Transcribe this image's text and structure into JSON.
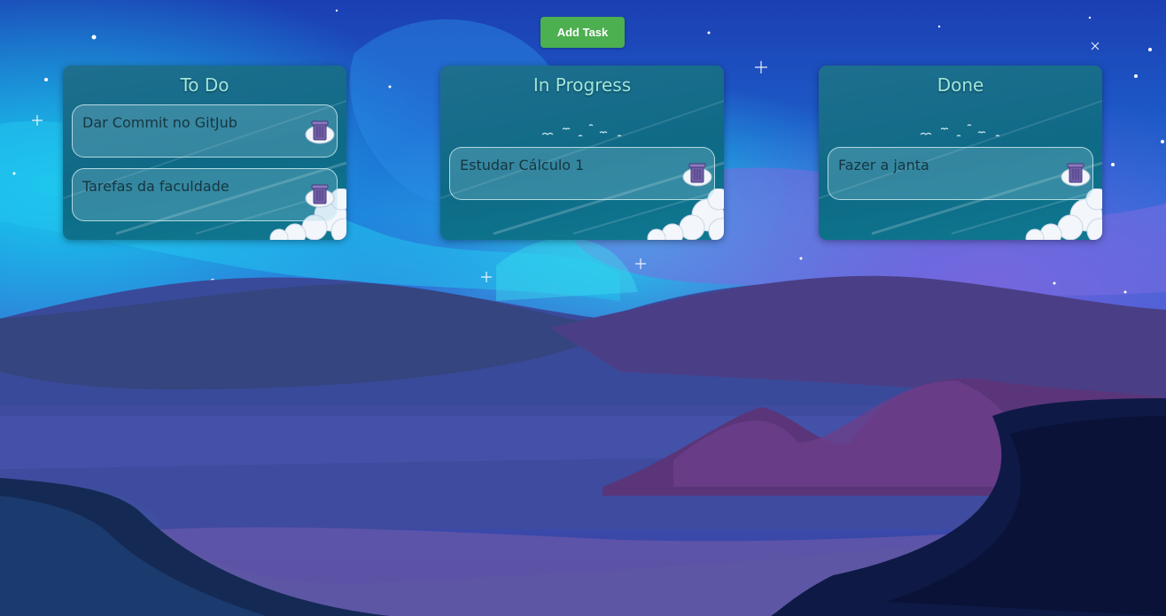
{
  "toolbar": {
    "add_task_label": "Add Task"
  },
  "columns": [
    {
      "title": "To Do",
      "tasks": [
        {
          "text": "Dar Commit no GitJub"
        },
        {
          "text": "Tarefas da faculdade"
        }
      ]
    },
    {
      "title": "In Progress",
      "tasks": [
        {
          "text": "Estudar Cálculo 1"
        }
      ]
    },
    {
      "title": "Done",
      "tasks": [
        {
          "text": "Fazer a janta"
        }
      ]
    }
  ],
  "colors": {
    "accent": "#4caf50",
    "column_bg": "#0e6a86",
    "title": "#9fe6dc"
  },
  "icons": {
    "delete_task": "trash-icon"
  }
}
